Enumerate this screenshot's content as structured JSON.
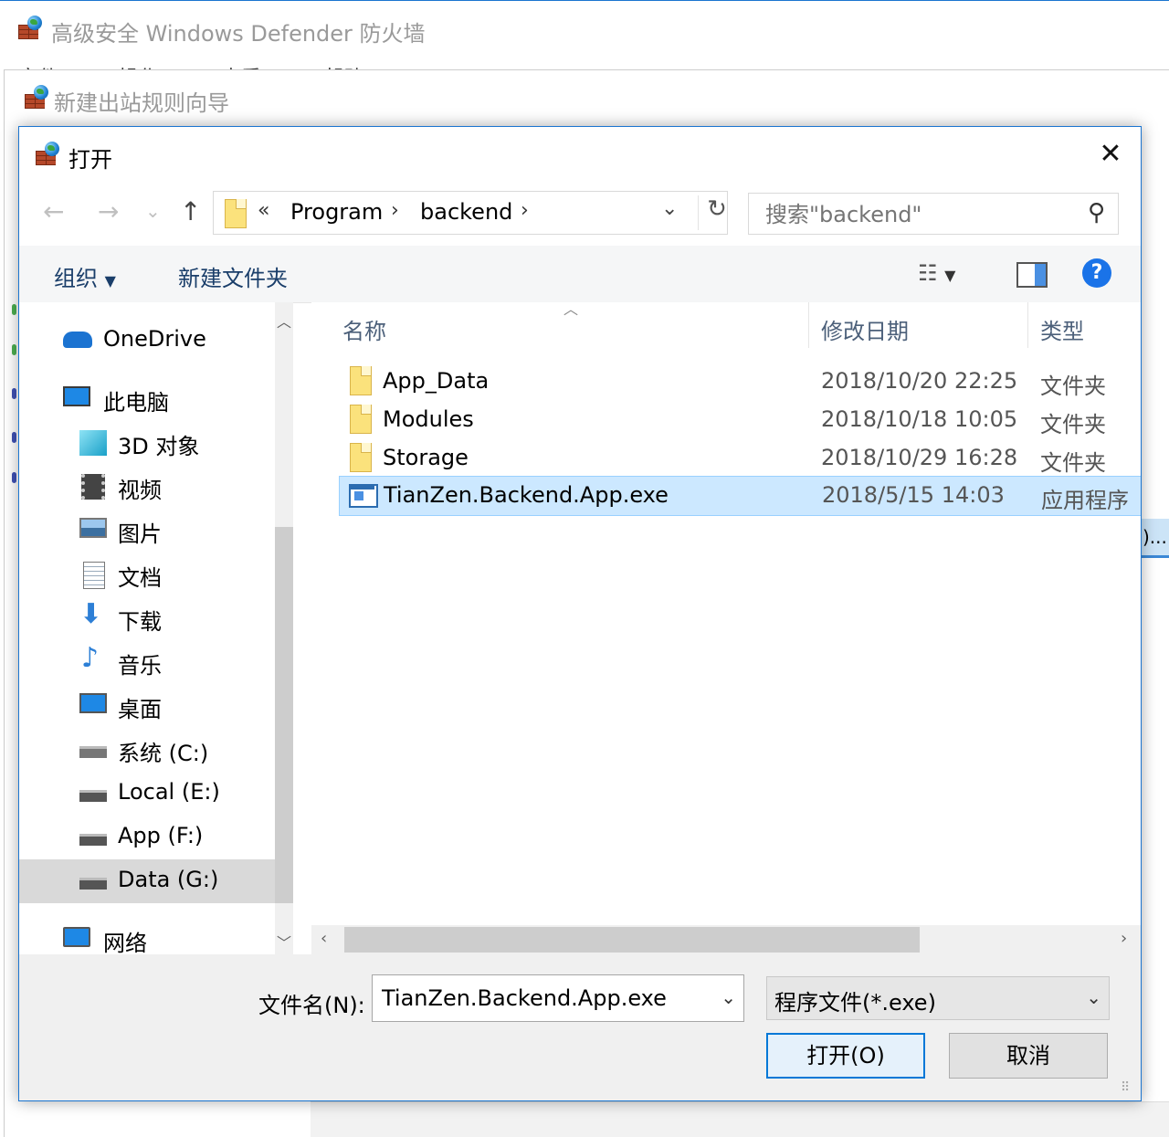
{
  "main_window": {
    "title": "高级安全 Windows Defender 防火墙",
    "menu": [
      "文件(F)",
      "操作(A)",
      "查看(V)",
      "帮助(H)"
    ]
  },
  "wizard": {
    "title": "新建出站规则向导",
    "right_item_fragment": ")..."
  },
  "dialog": {
    "title": "打开",
    "address": {
      "overflow": "«",
      "crumbs": [
        "Program",
        "backend"
      ]
    },
    "search": {
      "placeholder": "搜索\"backend\""
    },
    "toolbar": {
      "organize": "组织",
      "new_folder": "新建文件夹"
    },
    "nav": {
      "items": [
        {
          "label": "OneDrive",
          "icon": "onedrive-icon"
        },
        {
          "label": "此电脑",
          "icon": "computer-icon"
        },
        {
          "label": "3D 对象",
          "icon": "3d-objects-icon"
        },
        {
          "label": "视频",
          "icon": "video-icon"
        },
        {
          "label": "图片",
          "icon": "pictures-icon"
        },
        {
          "label": "文档",
          "icon": "documents-icon"
        },
        {
          "label": "下载",
          "icon": "download-icon"
        },
        {
          "label": "音乐",
          "icon": "music-icon"
        },
        {
          "label": "桌面",
          "icon": "desktop-icon"
        },
        {
          "label": "系统 (C:)",
          "icon": "system-drive-icon"
        },
        {
          "label": "Local (E:)",
          "icon": "drive-icon"
        },
        {
          "label": "App (F:)",
          "icon": "drive-icon"
        },
        {
          "label": "Data (G:)",
          "icon": "drive-icon",
          "selected": true
        },
        {
          "label": "网络",
          "icon": "network-icon"
        }
      ]
    },
    "columns": {
      "name": "名称",
      "date": "修改日期",
      "type": "类型"
    },
    "files": [
      {
        "name": "App_Data",
        "date": "2018/10/20 22:25",
        "type": "文件夹",
        "icon": "folder-icon"
      },
      {
        "name": "Modules",
        "date": "2018/10/18 10:05",
        "type": "文件夹",
        "icon": "folder-icon"
      },
      {
        "name": "Storage",
        "date": "2018/10/29 16:28",
        "type": "文件夹",
        "icon": "folder-icon"
      },
      {
        "name": "TianZen.Backend.App.exe",
        "date": "2018/5/15 14:03",
        "type": "应用程序",
        "icon": "exe-icon",
        "selected": true
      }
    ],
    "filename_label": "文件名(N):",
    "filename_value": "TianZen.Backend.App.exe",
    "filetype_value": "程序文件(*.exe)",
    "open_button": "打开(O)",
    "cancel_button": "取消"
  }
}
